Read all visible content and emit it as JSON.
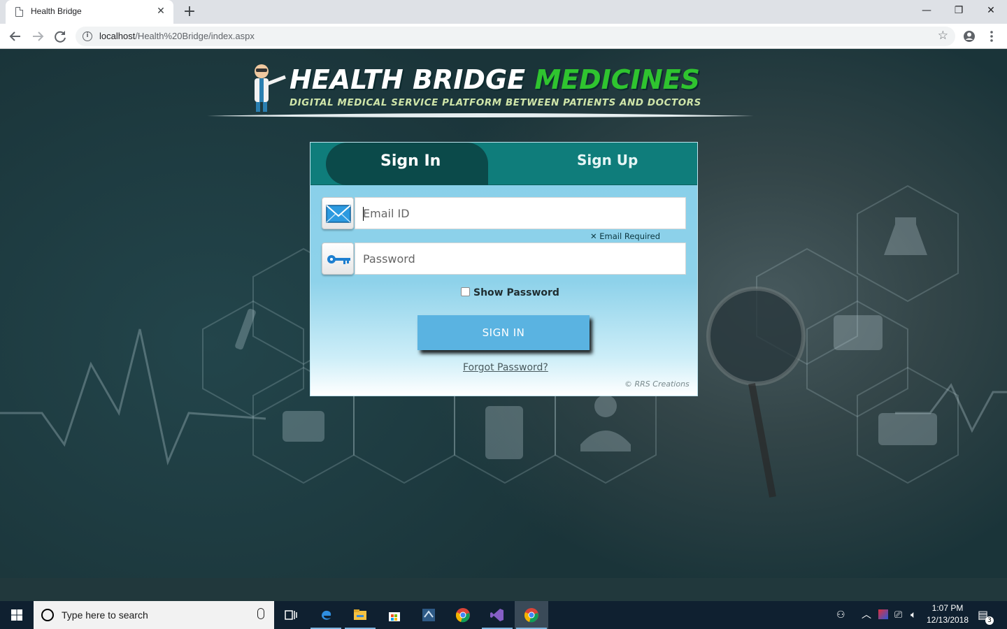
{
  "browser": {
    "tab_title": "Health Bridge",
    "tab_close": "✕",
    "new_tab": "+",
    "url_host": "localhost",
    "url_path": "/Health%20Bridge/index.aspx",
    "window_controls": {
      "minimize": "—",
      "maximize": "❐",
      "close": "✕"
    }
  },
  "logo": {
    "title_part1": "HEALTH BRIDGE",
    "title_part2": "MEDICINES",
    "subtitle": "DIGITAL MEDICAL SERVICE PLATFORM BETWEEN PATIENTS AND DOCTORS"
  },
  "login": {
    "tabs": {
      "signin": "Sign In",
      "signup": "Sign Up"
    },
    "email_placeholder": "Email ID",
    "email_error": "✕ Email Required",
    "password_placeholder": "Password",
    "show_password_label": "Show Password",
    "signin_button": "SIGN IN",
    "forgot_link": "Forgot Password?",
    "copyright": "© RRS Creations"
  },
  "taskbar": {
    "search_placeholder": "Type here to search",
    "time": "1:07 PM",
    "date": "12/13/2018",
    "notification_count": "3",
    "apps": [
      "task-view",
      "edge",
      "file-explorer",
      "store",
      "sql-server",
      "chrome",
      "visual-studio",
      "chrome-active"
    ]
  },
  "colors": {
    "tab_header": "#0f7d7b",
    "active_tab": "#0b4a4a",
    "card_blue": "#87cfe9",
    "button": "#5ab3e1",
    "logo_green": "#2fc42f"
  }
}
